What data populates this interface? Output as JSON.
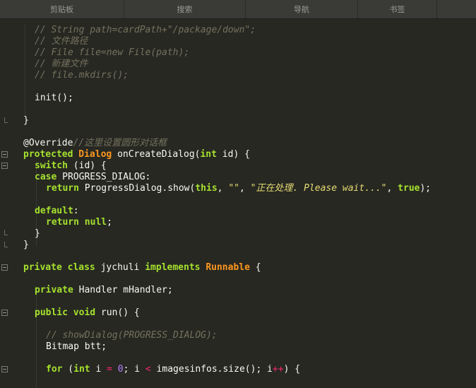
{
  "tabs": [
    "剪贴板",
    "搜索",
    "导航",
    "书签"
  ],
  "code": {
    "l1": "// String path=cardPath+\"/package/down\";",
    "l2": "// 文件路径",
    "l3": "// File file=new File(path);",
    "l4": "// 新建文件",
    "l5": "// file.mkdirs();",
    "l6": "init();",
    "l7": "}",
    "l8a": "@Override",
    "l8b": "//这里设置圆形对话框",
    "l9a": "protected",
    "l9b": "Dialog",
    "l9c": " onCreateDialog(",
    "l9d": "int",
    "l9e": " id) {",
    "l10a": "switch",
    "l10b": " (id) {",
    "l11a": "case",
    "l11b": " PROGRESS_DIALOG:",
    "l12a": "return",
    "l12b": " ProgressDialog.show(",
    "l12c": "this",
    "l12d": ", ",
    "l12e": "\"\"",
    "l12f": ", ",
    "l12g": "\"正在处理. Please wait...\"",
    "l12h": ", ",
    "l12i": "true",
    "l12j": ");",
    "l13a": "default",
    "l13b": ":",
    "l14a": "return",
    "l14b": "null",
    "l14c": ";",
    "l15": "}",
    "l16": "}",
    "l17a": "private",
    "l17b": "class",
    "l17c": " jychuli ",
    "l17d": "implements",
    "l17e": "Runnable",
    "l17f": " {",
    "l18a": "private",
    "l18b": " Handler mHandler;",
    "l19a": "public",
    "l19b": "void",
    "l19c": " run() {",
    "l20": "// showDialog(PROGRESS_DIALOG);",
    "l21": "Bitmap btt;",
    "l22a": "for",
    "l22b": " (",
    "l22c": "int",
    "l22d": " i ",
    "l22e": "=",
    "l22f": "0",
    "l22g": "; i ",
    "l22h": "<",
    "l22i": " imagesinfos.size(); i",
    "l22j": "++",
    "l22k": ") {"
  }
}
